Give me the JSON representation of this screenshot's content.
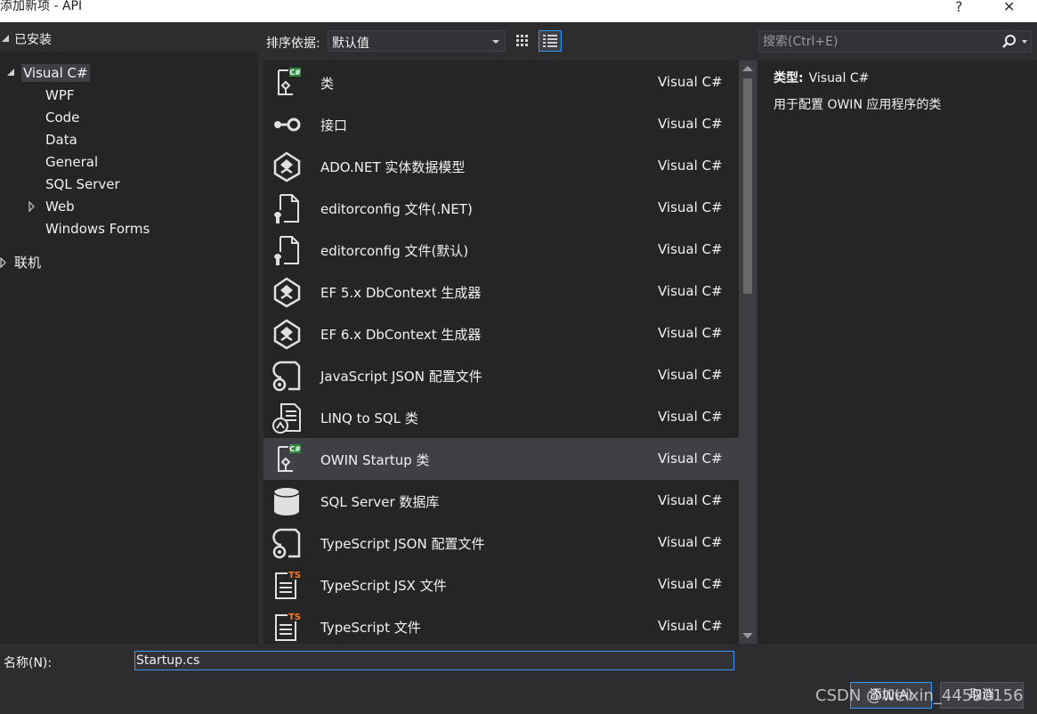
{
  "window": {
    "title": "添加新项 - API",
    "help_glyph": "?",
    "close_glyph": "✕"
  },
  "tree": {
    "header": "已安装",
    "root": "Visual C#",
    "children": [
      "WPF",
      "Code",
      "Data",
      "General",
      "SQL Server",
      "Web",
      "Windows Forms"
    ],
    "online": "联机"
  },
  "toolbar": {
    "sort_label": "排序依据:",
    "sort_value": "默认值"
  },
  "search": {
    "placeholder": "搜索(Ctrl+E)"
  },
  "items": [
    {
      "name": "类",
      "lang": "Visual C#",
      "icon": "csharp-class-icon"
    },
    {
      "name": "接口",
      "lang": "Visual C#",
      "icon": "interface-icon"
    },
    {
      "name": "ADO.NET 实体数据模型",
      "lang": "Visual C#",
      "icon": "entity-model-icon"
    },
    {
      "name": "editorconfig 文件(.NET)",
      "lang": "Visual C#",
      "icon": "config-file-icon"
    },
    {
      "name": "editorconfig 文件(默认)",
      "lang": "Visual C#",
      "icon": "config-file-icon"
    },
    {
      "name": "EF 5.x DbContext 生成器",
      "lang": "Visual C#",
      "icon": "entity-model-icon"
    },
    {
      "name": "EF 6.x DbContext 生成器",
      "lang": "Visual C#",
      "icon": "entity-model-icon"
    },
    {
      "name": "JavaScript JSON 配置文件",
      "lang": "Visual C#",
      "icon": "json-config-icon"
    },
    {
      "name": "LINQ to SQL 类",
      "lang": "Visual C#",
      "icon": "linq-icon"
    },
    {
      "name": "OWIN Startup 类",
      "lang": "Visual C#",
      "icon": "csharp-class-icon"
    },
    {
      "name": "SQL Server 数据库",
      "lang": "Visual C#",
      "icon": "database-icon"
    },
    {
      "name": "TypeScript JSON 配置文件",
      "lang": "Visual C#",
      "icon": "json-config-icon"
    },
    {
      "name": "TypeScript JSX 文件",
      "lang": "Visual C#",
      "icon": "typescript-file-icon"
    },
    {
      "name": "TypeScript 文件",
      "lang": "Visual C#",
      "icon": "typescript-file-icon"
    }
  ],
  "selected_index": 9,
  "details": {
    "type_label": "类型:",
    "type_value": "Visual C#",
    "description": "用于配置 OWIN 应用程序的类"
  },
  "bottom": {
    "name_label": "名称(N):",
    "name_value": "Startup.cs",
    "add_button": "添加(A)",
    "cancel_button": "取消",
    "watermark": "CSDN @weixin_44590156"
  },
  "colors": {
    "background": "#2d2d30",
    "panel": "#252526",
    "selection": "#3f3f46",
    "accent": "#3399ff"
  }
}
